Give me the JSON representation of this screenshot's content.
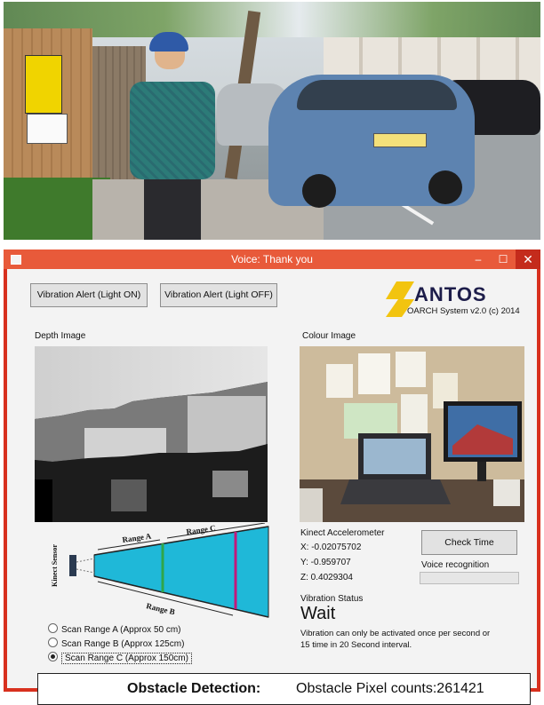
{
  "window": {
    "title": "Voice: Thank you",
    "minimize": "–",
    "maximize": "☐",
    "close": "✕"
  },
  "buttons": {
    "vibration_on": "Vibration Alert (Light ON)",
    "vibration_off": "Vibration Alert (Light OFF)",
    "check_time": "Check Time"
  },
  "logo": {
    "name": "ANTOS",
    "subtitle": "OARCH System v2.0 (c) 2014"
  },
  "labels": {
    "depth_image": "Depth Image",
    "colour_image": "Colour Image"
  },
  "diagram": {
    "sensor": "Kinect Sensor",
    "range_a": "Range A",
    "range_b": "Range B",
    "range_c": "Range C"
  },
  "scan_ranges": [
    {
      "label": "Scan Range A (Approx 50 cm)",
      "selected": false
    },
    {
      "label": "Scan Range B (Approx 125cm)",
      "selected": false
    },
    {
      "label": "Scan Range C (Approx  150cm)",
      "selected": true
    }
  ],
  "accelerometer": {
    "title": "Kinect Accelerometer",
    "x": "X: -0.02075702",
    "y": "Y: -0.959707",
    "z": "Z: 0.4029304"
  },
  "voice": {
    "label": "Voice recognition",
    "progress": 0
  },
  "vibration": {
    "title": "Vibration Status",
    "state": "Wait",
    "note_line1": "Vibration can only be activated once per second or",
    "note_line2": "15 time in 20 Second interval."
  },
  "obstacle": {
    "label": "Obstacle Detection:",
    "value": "Obstacle Pixel counts:261421"
  },
  "colors": {
    "titlebar": "#e85a3a",
    "close": "#c42b1c",
    "range_fill": "#1fb8d8",
    "range_a_line": "#2fa64a",
    "range_b_line": "#c2187a",
    "logo_yellow": "#f2c40f"
  }
}
